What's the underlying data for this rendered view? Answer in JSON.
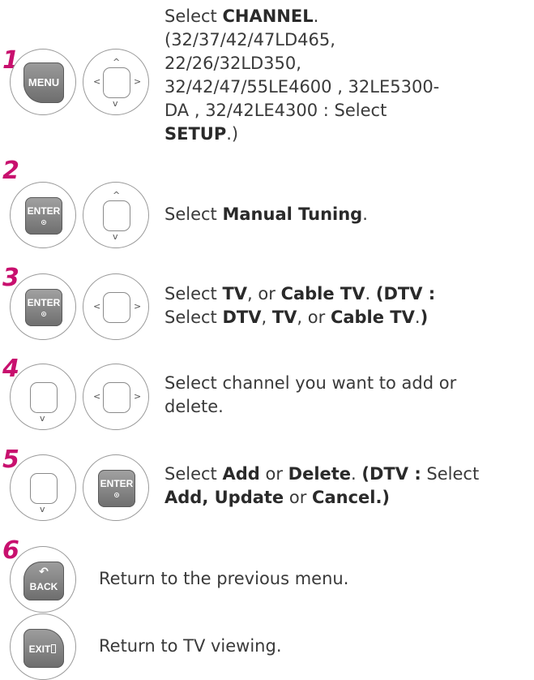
{
  "steps": [
    {
      "number": "1",
      "key1_label": "MENU",
      "text_a": "Select ",
      "bold_a": "CHANNEL",
      "text_b": ".",
      "text_c": "(32/37/42/47LD465,",
      "text_d": "22/26/32LD350,",
      "text_e": "32/42/47/55LE4600 , 32LE5300-",
      "text_f": "DA , 32/42LE4300 : Select",
      "bold_b": "SETUP",
      "text_g": ".)"
    },
    {
      "number": "2",
      "key1_label": "ENTER",
      "text_a": "Select ",
      "bold_a": "Manual Tuning",
      "text_b": "."
    },
    {
      "number": "3",
      "key1_label": "ENTER",
      "text_a": "Select ",
      "bold_a": "TV",
      "text_b": ", or ",
      "bold_b": "Cable TV",
      "text_c": ". ",
      "bold_c": "(DTV :",
      "text_d": "Select ",
      "bold_d": "DTV",
      "text_e": ", ",
      "bold_e": "TV",
      "text_f": ", or ",
      "bold_f": "Cable TV",
      "text_g": ".",
      "bold_g": ")"
    },
    {
      "number": "4",
      "text_a": "Select channel you want to add or",
      "text_b": "delete."
    },
    {
      "number": "5",
      "key2_label": "ENTER",
      "text_a": "Select ",
      "bold_a": "Add",
      "text_b": " or ",
      "bold_b": "Delete",
      "text_c": ". ",
      "bold_c": "(DTV :",
      "text_d": " Select",
      "bold_d": "Add, Update",
      "text_e": " or ",
      "bold_e": "Cancel.)"
    },
    {
      "number": "6",
      "key1_label": "BACK",
      "text_a": "Return to the previous menu."
    },
    {
      "key1_label": "EXIT",
      "text_a": "Return to TV viewing."
    }
  ],
  "icons": {
    "arrow_up": "^",
    "arrow_down": "v",
    "arrow_left": "<",
    "arrow_right": ">",
    "back_arrow": "↶"
  },
  "colors": {
    "step_number": "#c8106e",
    "key_gray": "#7f7f7f"
  }
}
